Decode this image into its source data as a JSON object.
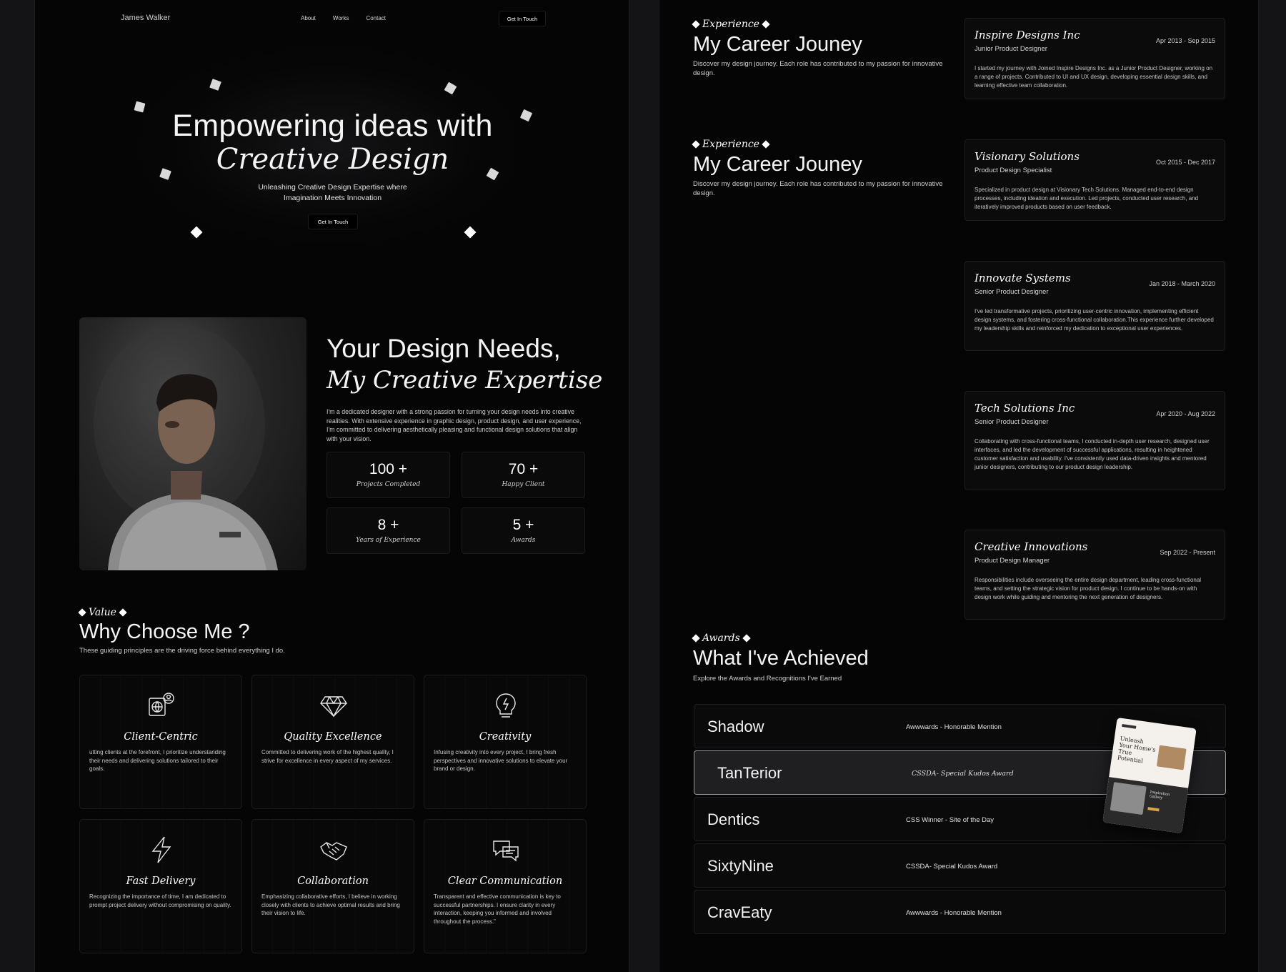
{
  "left": {
    "nav": {
      "brand": "James Walker",
      "links": [
        "About",
        "Works",
        "Contact"
      ],
      "cta": "Get In Touch"
    },
    "hero": {
      "line1": "Empowering ideas with",
      "line2": "Creative Design",
      "sub_line1": "Unleashing Creative Design Expertise where",
      "sub_line2": "Imagination Meets Innovation",
      "cta": "Get In Touch"
    },
    "about": {
      "title1": "Your Design Needs,",
      "title2": "My Creative Expertise",
      "paragraph": "I'm a dedicated designer with a strong passion for turning your design needs into creative realities. With extensive experience in graphic design, product design, and user experience, I'm committed to delivering aesthetically pleasing and functional design solutions that align with your vision.",
      "stats": [
        {
          "value": "100 +",
          "label": "Projects Completed"
        },
        {
          "value": "70 +",
          "label": "Happy Client"
        },
        {
          "value": "8 +",
          "label": "Years of Experience"
        },
        {
          "value": "5 +",
          "label": "Awards"
        }
      ]
    },
    "values": {
      "eyebrow": "Value",
      "title": "Why Choose Me ?",
      "subtitle": "These guiding principles are the driving force behind everything I do.",
      "cards": [
        {
          "icon": "globe-user-icon",
          "title": "Client-Centric",
          "text": "utting clients at the forefront, I prioritize understanding their needs and delivering solutions tailored to their goals."
        },
        {
          "icon": "diamond-icon",
          "title": "Quality Excellence",
          "text": "Committed to delivering work of the highest quality, I strive for excellence in every aspect of my services."
        },
        {
          "icon": "lightbulb-icon",
          "title": "Creativity",
          "text": "Infusing creativity into every project, I bring fresh perspectives and innovative solutions to elevate your brand or design."
        },
        {
          "icon": "lightning-icon",
          "title": "Fast Delivery",
          "text": "Recognizing the importance of time, I am dedicated to prompt project delivery without compromising on quality."
        },
        {
          "icon": "handshake-icon",
          "title": "Collaboration",
          "text": "Emphasizing collaborative efforts, I believe in working closely with clients to achieve optimal results and bring their vision to life."
        },
        {
          "icon": "chat-bubbles-icon",
          "title": "Clear Communication",
          "text": "Transparent and effective communication is key to successful partnerships. I ensure clarity in every interaction, keeping you informed and involved throughout the process.\""
        }
      ]
    }
  },
  "right": {
    "experience_blocks": [
      {
        "eyebrow": "Experience",
        "title": "My Career Jouney",
        "subtitle": "Discover my design journey. Each role has contributed to my passion for innovative design."
      },
      {
        "eyebrow": "Experience",
        "title": "My Career Jouney",
        "subtitle": "Discover my design journey. Each role has contributed to my passion for innovative design."
      }
    ],
    "jobs": [
      {
        "company": "Inspire Designs Inc",
        "dates": "Apr 2013 - Sep 2015",
        "role": "Junior Product Designer",
        "desc": "I started my journey with Joined Inspire Designs Inc. as a Junior Product Designer, working on a range of projects. Contributed to UI and UX design, developing essential design skills, and learning effective team collaboration."
      },
      {
        "company": "Visionary Solutions",
        "dates": "Oct 2015 - Dec 2017",
        "role": "Product Design Specialist",
        "desc": "Specialized in product design at Visionary Tech Solutions. Managed end-to-end design processes, including ideation and execution. Led projects, conducted user research, and iteratively improved products based on user feedback."
      },
      {
        "company": "Innovate Systems",
        "dates": "Jan 2018 - March 2020",
        "role": "Senior Product Designer",
        "desc": "I've led transformative projects, prioritizing user-centric innovation, implementing efficient design systems, and fostering cross-functional collaboration.This experience further developed my leadership skills and reinforced my dedication to exceptional user experiences."
      },
      {
        "company": "Tech Solutions Inc",
        "dates": "Apr 2020 - Aug 2022",
        "role": "Senior Product Designer",
        "desc": "Collaborating with cross-functional teams, I conducted in-depth user research, designed user interfaces, and led the development of successful applications, resulting in heightened customer satisfaction and usability. I've consistently used data-driven insights and mentored junior designers, contributing to our product design leadership."
      },
      {
        "company": "Creative Innovations",
        "dates": "Sep 2022 - Present",
        "role": "Product Design Manager",
        "desc": "Responsibilities include overseeing the entire design department, leading cross-functional teams, and setting the strategic vision for product design. I continue to be hands-on with design work while guiding and mentoring the next generation of designers."
      }
    ],
    "awards": {
      "eyebrow": "Awards",
      "title": "What I've Achieved",
      "subtitle": "Explore the Awards and Recognitions I've Earned",
      "rows": [
        {
          "name": "Shadow",
          "award": "Awwwards - Honorable Mention"
        },
        {
          "name": "TanTerior",
          "award": "CSSDA- Special Kudos Award"
        },
        {
          "name": "Dentics",
          "award": "CSS Winner - Site of the Day"
        },
        {
          "name": "SixtyNine",
          "award": "CSSDA- Special Kudos Award"
        },
        {
          "name": "CravEaty",
          "award": "Awwwards - Honorable Mention"
        }
      ],
      "preview": {
        "heading": "Unleash Your Home's True Potential",
        "caption": "Inspiration Gallery"
      }
    }
  }
}
